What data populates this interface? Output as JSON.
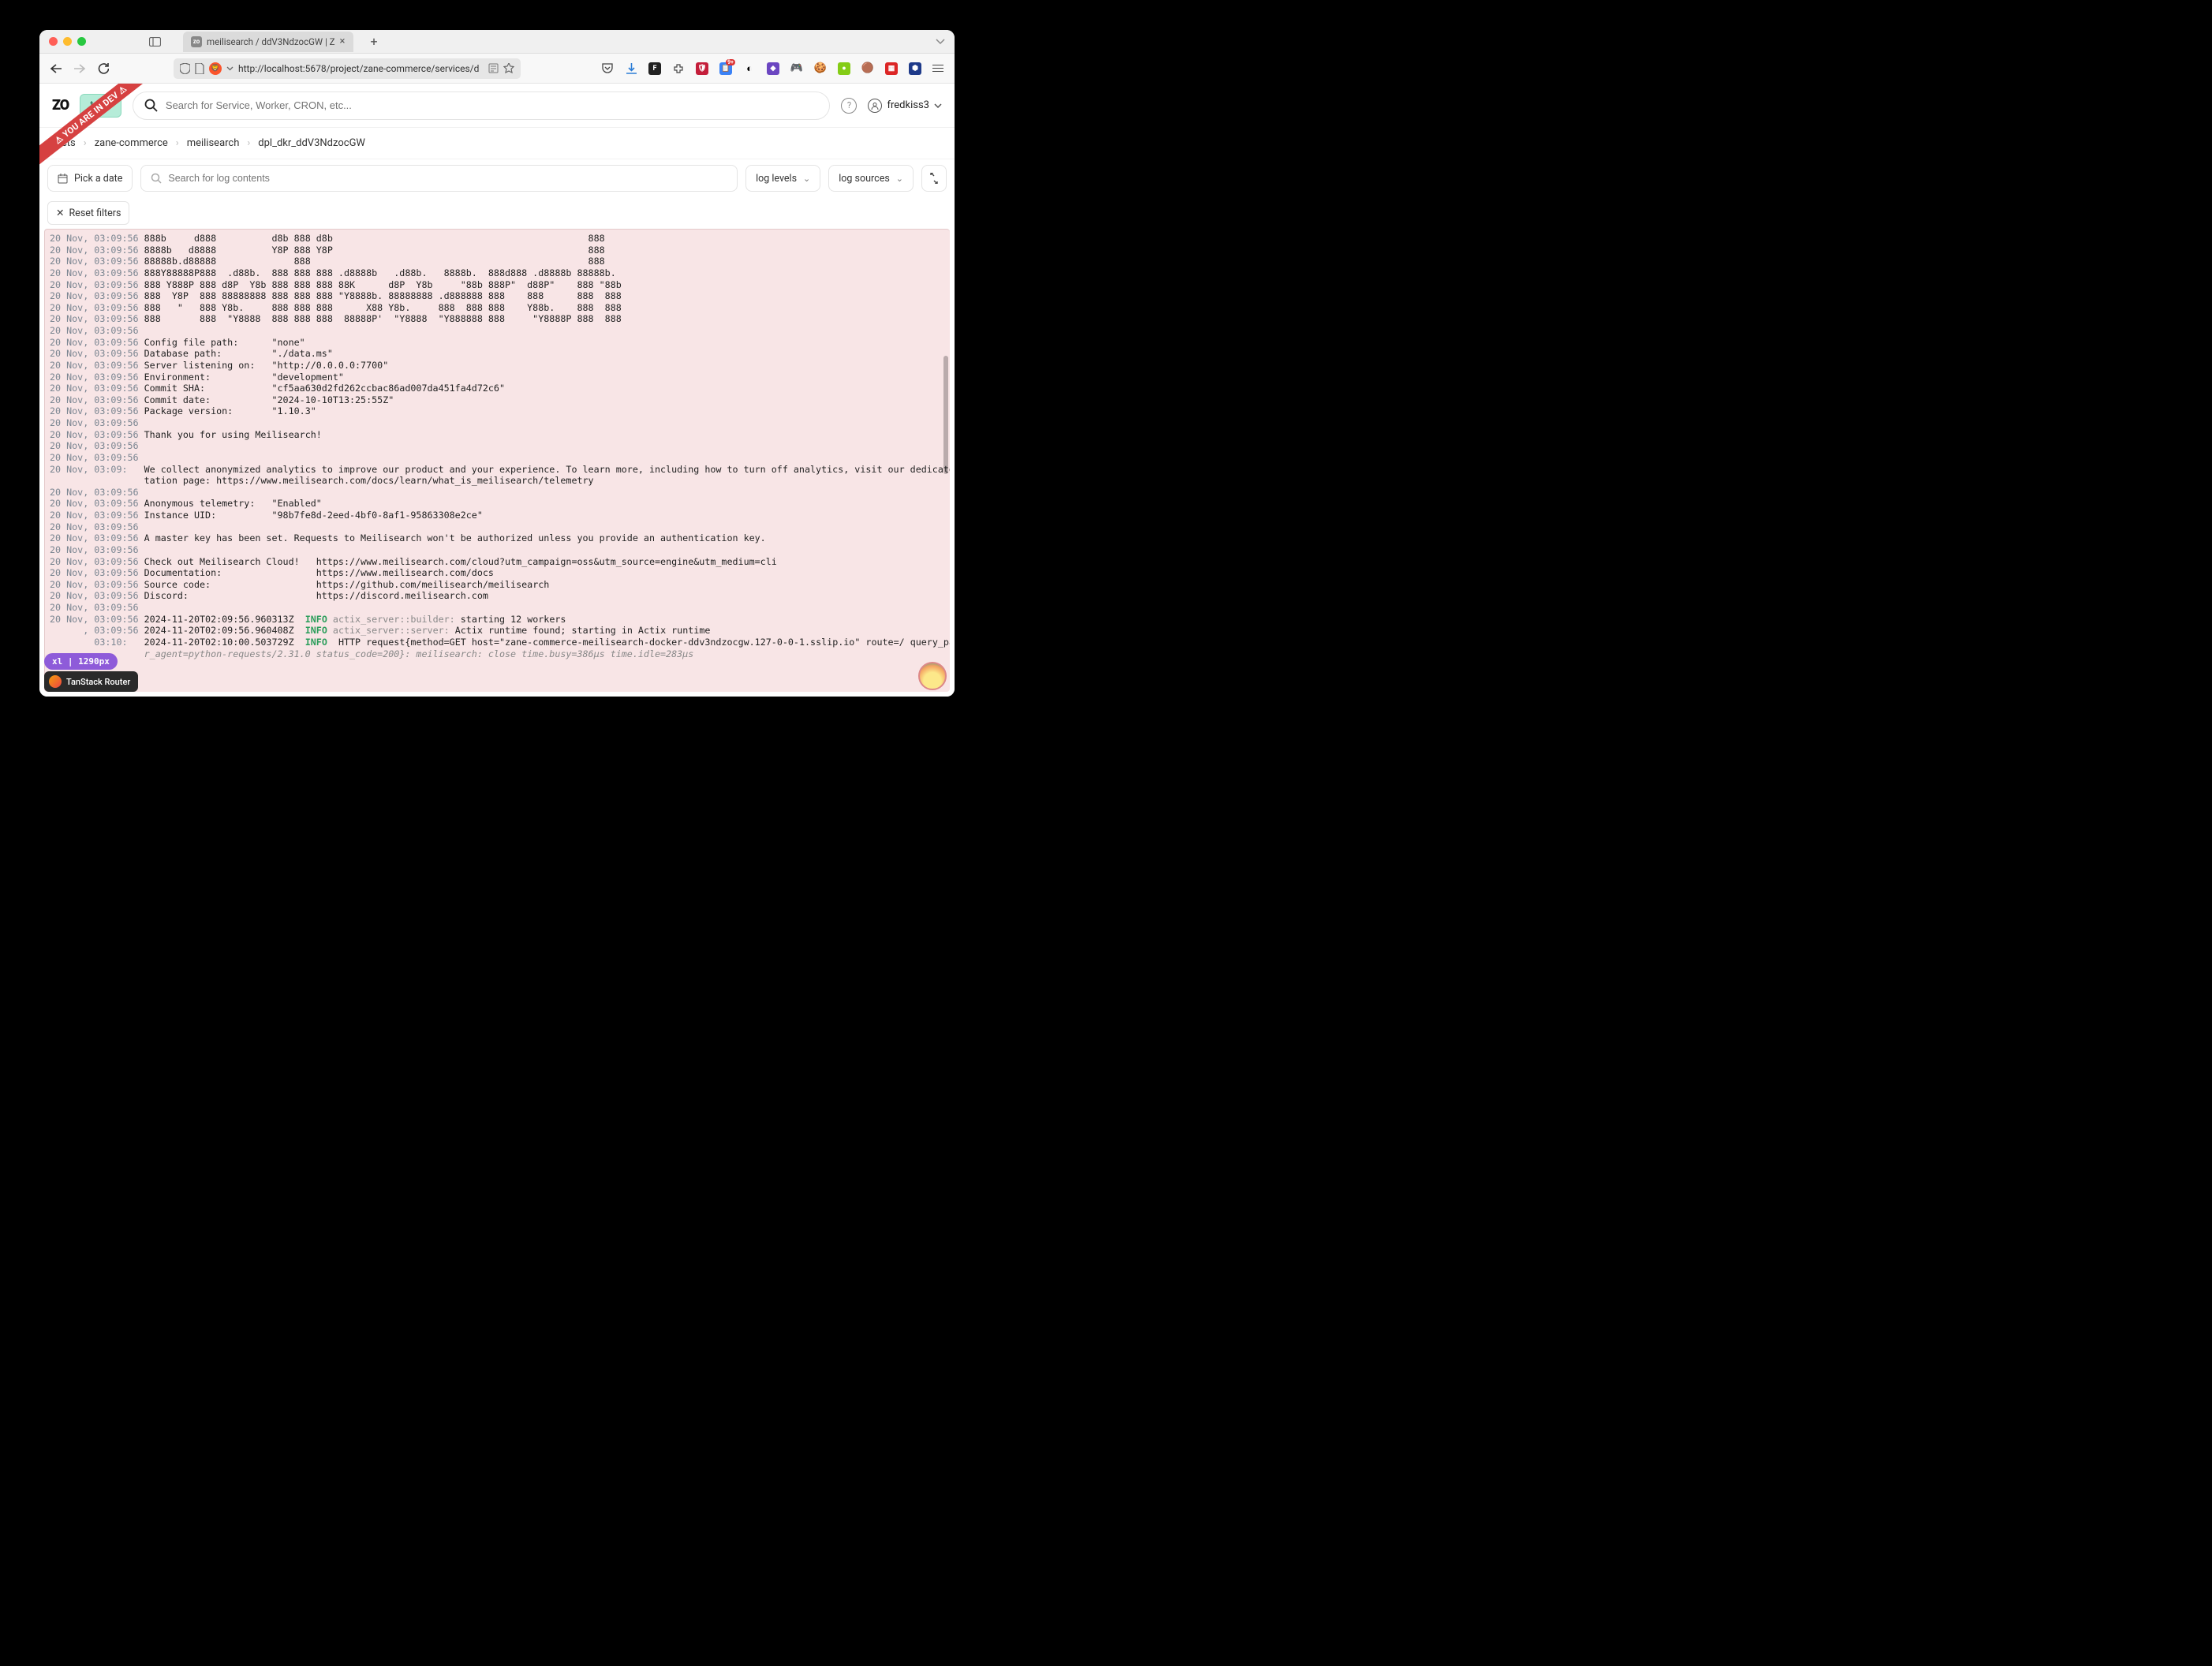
{
  "browser": {
    "tab_title": "meilisearch / ddV3NdzocGW | Z",
    "url": "http://localhost:5678/project/zane-commerce/services/d"
  },
  "ribbon": "⚠ YOU ARE IN DEV ⚠",
  "header": {
    "logo": "ZO",
    "create_label": "te",
    "search_placeholder": "Search for Service, Worker, CRON, etc...",
    "username": "fredkiss3"
  },
  "breadcrumbs": [
    "jects",
    "zane-commerce",
    "meilisearch",
    "dpl_dkr_ddV3NdzocGW"
  ],
  "filters": {
    "date_label": "Pick a date",
    "search_placeholder": "Search for log contents",
    "levels_label": "log levels",
    "sources_label": "log sources",
    "reset_label": "Reset filters"
  },
  "breakpoint_label": "xl | 1290px",
  "tanstack_label": "TanStack Router",
  "logs": [
    {
      "ts": "20 Nov, 03:09:56",
      "txt": "888b     d888          d8b 888 d8b                                              888"
    },
    {
      "ts": "20 Nov, 03:09:56",
      "txt": "8888b   d8888          Y8P 888 Y8P                                              888"
    },
    {
      "ts": "20 Nov, 03:09:56",
      "txt": "88888b.d88888              888                                                  888"
    },
    {
      "ts": "20 Nov, 03:09:56",
      "txt": "888Y88888P888  .d88b.  888 888 888 .d8888b   .d88b.   8888b.  888d888 .d8888b 88888b."
    },
    {
      "ts": "20 Nov, 03:09:56",
      "txt": "888 Y888P 888 d8P  Y8b 888 888 888 88K      d8P  Y8b     \"88b 888P\"  d88P\"    888 \"88b"
    },
    {
      "ts": "20 Nov, 03:09:56",
      "txt": "888  Y8P  888 88888888 888 888 888 \"Y8888b. 88888888 .d888888 888    888      888  888"
    },
    {
      "ts": "20 Nov, 03:09:56",
      "txt": "888   \"   888 Y8b.     888 888 888      X88 Y8b.     888  888 888    Y88b.    888  888"
    },
    {
      "ts": "20 Nov, 03:09:56",
      "txt": "888       888  \"Y8888  888 888 888  88888P'  \"Y8888  \"Y888888 888     \"Y8888P 888  888"
    },
    {
      "ts": "20 Nov, 03:09:56",
      "txt": ""
    },
    {
      "ts": "20 Nov, 03:09:56",
      "txt": "Config file path:\t\"none\""
    },
    {
      "ts": "20 Nov, 03:09:56",
      "txt": "Database path:\t\t\"./data.ms\""
    },
    {
      "ts": "20 Nov, 03:09:56",
      "txt": "Server listening on:\t\"http://0.0.0.0:7700\""
    },
    {
      "ts": "20 Nov, 03:09:56",
      "txt": "Environment:\t\t\"development\""
    },
    {
      "ts": "20 Nov, 03:09:56",
      "txt": "Commit SHA:\t\t\"cf5aa630d2fd262ccbac86ad007da451fa4d72c6\""
    },
    {
      "ts": "20 Nov, 03:09:56",
      "txt": "Commit date:\t\t\"2024-10-10T13:25:55Z\""
    },
    {
      "ts": "20 Nov, 03:09:56",
      "txt": "Package version:\t\"1.10.3\""
    },
    {
      "ts": "20 Nov, 03:09:56",
      "txt": ""
    },
    {
      "ts": "20 Nov, 03:09:56",
      "txt": "Thank you for using Meilisearch!"
    },
    {
      "ts": "20 Nov, 03:09:56",
      "txt": ""
    },
    {
      "ts": "20 Nov, 03:09:56",
      "txt": ""
    },
    {
      "ts": "20 Nov, 03:09:  ",
      "txt": "We collect anonymized analytics to improve our product and your experience. To learn more, including how to turn off analytics, visit our dedicated documen"
    },
    {
      "ts": "                ",
      "txt": "tation page: https://www.meilisearch.com/docs/learn/what_is_meilisearch/telemetry"
    },
    {
      "ts": "20 Nov, 03:09:56",
      "txt": ""
    },
    {
      "ts": "20 Nov, 03:09:56",
      "txt": "Anonymous telemetry:\t\"Enabled\""
    },
    {
      "ts": "20 Nov, 03:09:56",
      "txt": "Instance UID:\t\t\"98b7fe8d-2eed-4bf0-8af1-95863308e2ce\""
    },
    {
      "ts": "20 Nov, 03:09:56",
      "txt": ""
    },
    {
      "ts": "20 Nov, 03:09:56",
      "txt": "A master key has been set. Requests to Meilisearch won't be authorized unless you provide an authentication key."
    },
    {
      "ts": "20 Nov, 03:09:56",
      "txt": ""
    },
    {
      "ts": "20 Nov, 03:09:56",
      "txt": "Check out Meilisearch Cloud!\thttps://www.meilisearch.com/cloud?utm_campaign=oss&utm_source=engine&utm_medium=cli"
    },
    {
      "ts": "20 Nov, 03:09:56",
      "txt": "Documentation:\t\t\thttps://www.meilisearch.com/docs"
    },
    {
      "ts": "20 Nov, 03:09:56",
      "txt": "Source code:\t\t\thttps://github.com/meilisearch/meilisearch"
    },
    {
      "ts": "20 Nov, 03:09:56",
      "txt": "Discord:\t\t\thttps://discord.meilisearch.com"
    },
    {
      "ts": "20 Nov, 03:09:56",
      "txt": ""
    }
  ],
  "logs_tail": [
    {
      "ts": "20 Nov, 03:09:56",
      "ts2": "2024-11-20T02:09:56.960313Z",
      "level": "INFO",
      "mod": "actix_server::builder:",
      "txt": "starting 12 workers"
    },
    {
      "ts": "      , 03:09:56",
      "ts2": "2024-11-20T02:09:56.960408Z",
      "level": "INFO",
      "mod": "actix_server::server:",
      "txt": "Actix runtime found; starting in Actix runtime"
    },
    {
      "ts": "        03:10:  ",
      "ts2": "2024-11-20T02:10:00.503729Z",
      "level": "INFO",
      "mod": "",
      "txt": "HTTP request{method=GET host=\"zane-commerce-meilisearch-docker-ddv3ndzocgw.127-0-0-1.sslip.io\" route=/ query_parameter",
      "tail": "r_agent=python-requests/2.31.0 status_code=200}: meilisearch: close time.busy=386µs time.idle=283µs"
    }
  ]
}
